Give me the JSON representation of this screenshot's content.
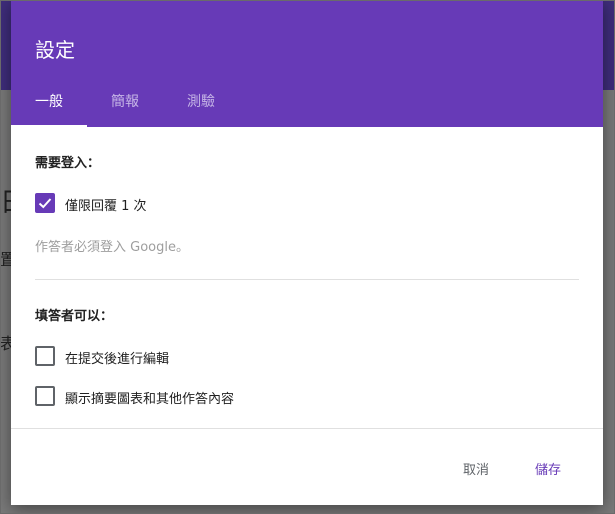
{
  "dialog": {
    "title": "設定",
    "tabs": [
      {
        "label": "一般",
        "active": true
      },
      {
        "label": "簡報",
        "active": false
      },
      {
        "label": "測驗",
        "active": false
      }
    ],
    "login_section": {
      "heading": "需要登入：",
      "limit_one_response": {
        "label": "僅限回覆 1 次",
        "checked": true
      },
      "hint": "作答者必須登入 Google。"
    },
    "respondents_section": {
      "heading": "填答者可以：",
      "edit_after_submit": {
        "label": "在提交後進行編輯",
        "checked": false
      },
      "see_summary": {
        "label": "顯示摘要圖表和其他作答內容",
        "checked": false
      }
    },
    "cancel_label": "取消",
    "save_label": "儲存"
  },
  "background": {
    "fragments": [
      "日",
      "置",
      "表"
    ]
  },
  "colors": {
    "accent": "#673ab7",
    "header_bg": "#673ab7",
    "overlay_topbar": "#3f2d7c"
  }
}
